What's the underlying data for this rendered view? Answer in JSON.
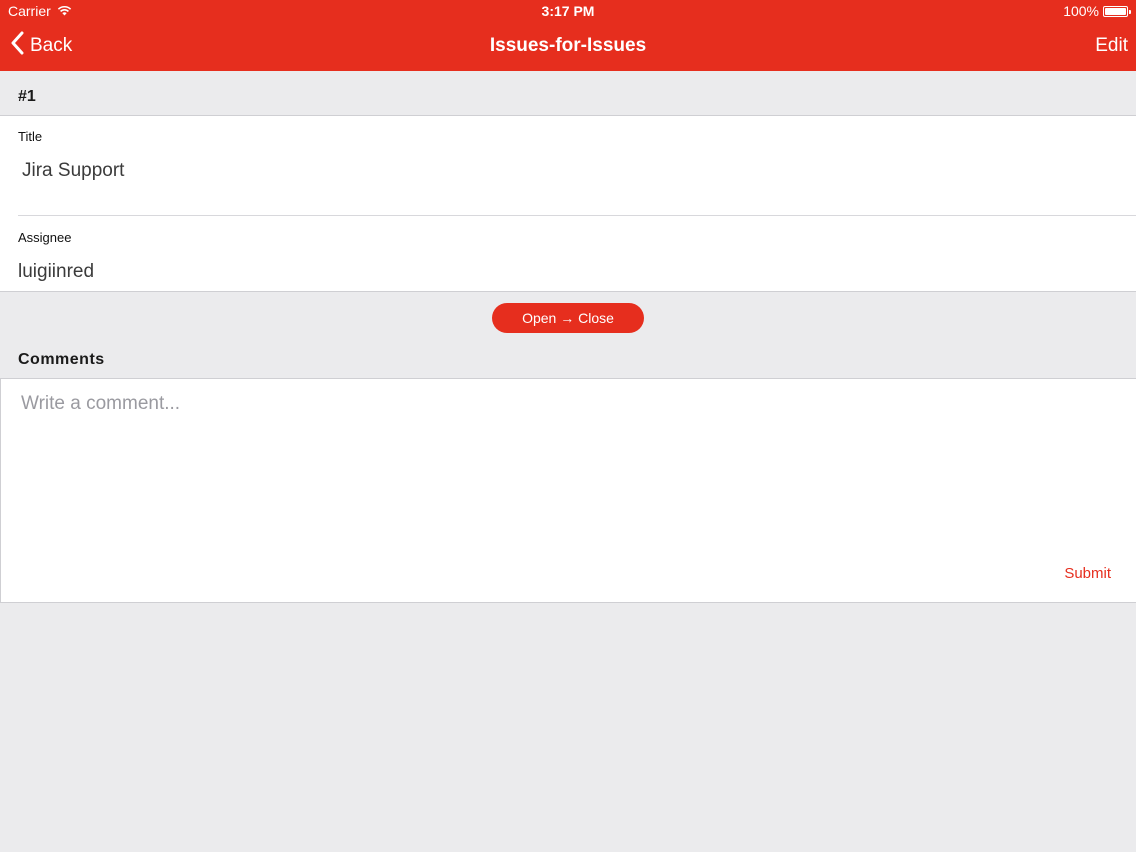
{
  "status_bar": {
    "carrier": "Carrier",
    "time": "3:17 PM",
    "battery_text": "100%",
    "battery_level": 1.0,
    "wifi_icon": "wifi-icon",
    "battery_icon": "battery-icon"
  },
  "nav": {
    "back_label": "Back",
    "back_icon": "chevron-left-icon",
    "title": "Issues-for-Issues",
    "edit_label": "Edit"
  },
  "issue": {
    "number": "#1",
    "title_label": "Title",
    "title_value": "Jira Support",
    "assignee_label": "Assignee",
    "assignee_value": "luigiinred"
  },
  "state_button": {
    "label": "Open → Close"
  },
  "comments": {
    "heading": "Comments",
    "placeholder": "Write a comment...",
    "value": "",
    "submit_label": "Submit"
  },
  "colors": {
    "accent": "#e62e1e",
    "background": "#ebebed",
    "card": "#ffffff"
  }
}
